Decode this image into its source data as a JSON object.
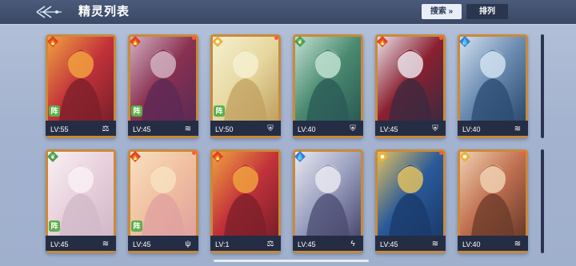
{
  "header": {
    "title": "精灵列表",
    "search_label": "搜索",
    "sort_label": "排列"
  },
  "badge_text": "阵",
  "colors": {
    "fire": "#d9432e",
    "grass": "#4aa04a",
    "water": "#3d7ad0",
    "light": "#e8b43a"
  },
  "cards": [
    {
      "level": "LV:55",
      "element": "fire",
      "class_icon": "scales-icon",
      "has_dot": false,
      "has_badge": true
    },
    {
      "level": "LV:45",
      "element": "fire",
      "class_icon": "wave-icon",
      "has_dot": true,
      "has_badge": true
    },
    {
      "level": "LV:50",
      "element": "light",
      "class_icon": "shield-icon",
      "has_dot": true,
      "has_badge": true
    },
    {
      "level": "LV:40",
      "element": "grass",
      "class_icon": "shield-icon",
      "has_dot": false,
      "has_badge": false
    },
    {
      "level": "LV:45",
      "element": "fire",
      "class_icon": "shield-icon",
      "has_dot": true,
      "has_badge": false
    },
    {
      "level": "LV:40",
      "element": "water",
      "class_icon": "wave-icon",
      "has_dot": false,
      "has_badge": false
    },
    {
      "level": "LV:45",
      "element": "grass",
      "class_icon": "wave-icon",
      "has_dot": false,
      "has_badge": true
    },
    {
      "level": "LV:45",
      "element": "fire",
      "class_icon": "trident-icon",
      "has_dot": true,
      "has_badge": true
    },
    {
      "level": "LV:1",
      "element": "fire",
      "class_icon": "scales-icon",
      "has_dot": false,
      "has_badge": false
    },
    {
      "level": "LV:45",
      "element": "water",
      "class_icon": "bolt-icon",
      "has_dot": false,
      "has_badge": false
    },
    {
      "level": "LV:45",
      "element": "light",
      "class_icon": "wave-icon",
      "has_dot": true,
      "has_badge": false
    },
    {
      "level": "LV:40",
      "element": "light",
      "class_icon": "wave-icon",
      "has_dot": true,
      "has_badge": false
    }
  ]
}
